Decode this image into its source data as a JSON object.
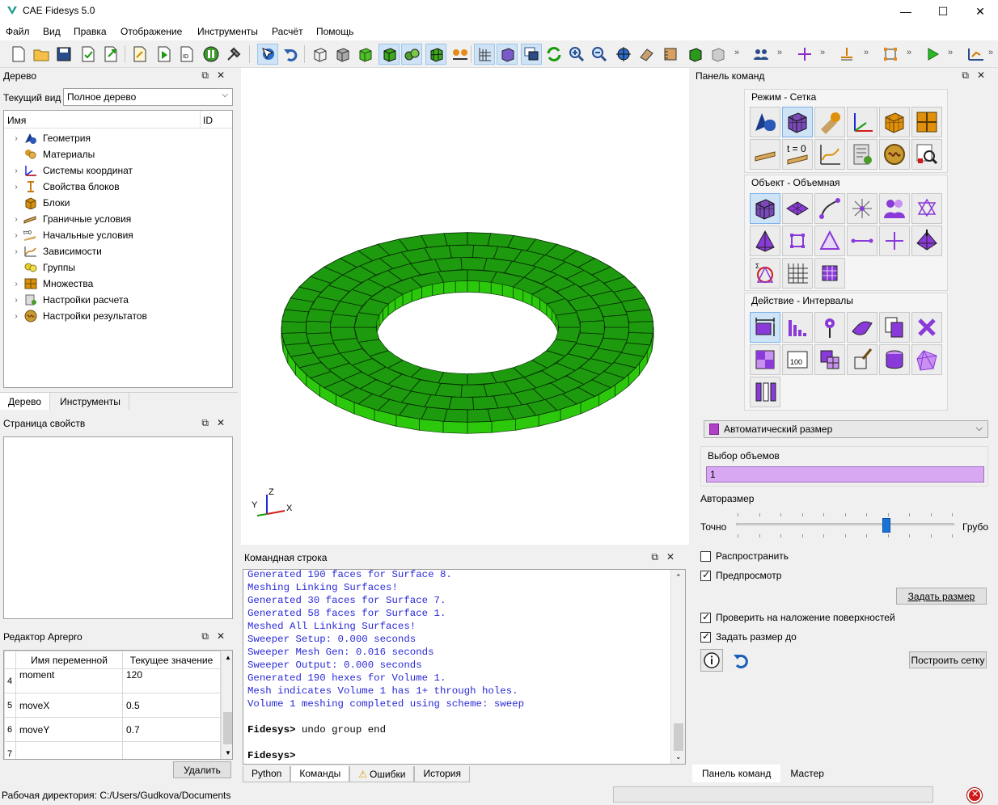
{
  "window": {
    "title": "CAE Fidesys 5.0",
    "minimize": "—",
    "maximize": "☐",
    "close": "✕"
  },
  "menu": [
    "Файл",
    "Вид",
    "Правка",
    "Отображение",
    "Инструменты",
    "Расчёт",
    "Помощь"
  ],
  "tree_panel": {
    "title": "Дерево",
    "view_label": "Текущий вид",
    "view_value": "Полное дерево",
    "col_name": "Имя",
    "col_id": "ID",
    "items": [
      {
        "label": "Геометрия",
        "expandable": true,
        "icon": "geometry-icon"
      },
      {
        "label": "Материалы",
        "expandable": false,
        "icon": "materials-icon"
      },
      {
        "label": "Системы координат",
        "expandable": true,
        "icon": "coordinate-systems-icon"
      },
      {
        "label": "Свойства блоков",
        "expandable": true,
        "icon": "block-properties-icon"
      },
      {
        "label": "Блоки",
        "expandable": false,
        "icon": "blocks-icon"
      },
      {
        "label": "Граничные условия",
        "expandable": true,
        "icon": "boundary-conditions-icon"
      },
      {
        "label": "Начальные условия",
        "expandable": true,
        "icon": "initial-conditions-icon"
      },
      {
        "label": "Зависимости",
        "expandable": true,
        "icon": "dependencies-icon"
      },
      {
        "label": "Группы",
        "expandable": false,
        "icon": "groups-icon"
      },
      {
        "label": "Множества",
        "expandable": true,
        "icon": "sets-icon"
      },
      {
        "label": "Настройки расчета",
        "expandable": true,
        "icon": "calc-settings-icon"
      },
      {
        "label": "Настройки результатов",
        "expandable": true,
        "icon": "results-settings-icon"
      }
    ],
    "tabs": [
      "Дерево",
      "Инструменты"
    ]
  },
  "property_panel": {
    "title": "Страница свойств"
  },
  "aprepro": {
    "title": "Редактор Aprepro",
    "col_name": "Имя переменной",
    "col_value": "Текущее значение",
    "rows": [
      {
        "n": "4",
        "name": "moment",
        "value": "120"
      },
      {
        "n": "5",
        "name": "moveX",
        "value": "0.5"
      },
      {
        "n": "6",
        "name": "moveY",
        "value": "0.7"
      },
      {
        "n": "7",
        "name": "",
        "value": ""
      }
    ],
    "delete_label": "Удалить"
  },
  "status_bar": {
    "workdir": "Рабочая директория: C:/Users/Gudkova/Documents"
  },
  "viewport": {
    "axis_x": "X",
    "axis_y": "Y",
    "axis_z": "Z",
    "mesh_color": "#1d9a0e"
  },
  "console": {
    "title": "Командная строка",
    "lines": [
      "Generated 190 faces for Surface 8.",
      "Meshing Linking Surfaces!",
      "Generated 30 faces for Surface 7.",
      "Generated 58 faces for Surface 1.",
      "Meshed All Linking Surfaces!",
      "Sweeper Setup: 0.000 seconds",
      "Sweeper Mesh Gen: 0.016 seconds",
      "Sweeper Output: 0.000 seconds",
      "Generated 190 hexes for Volume 1.",
      "Mesh indicates Volume 1 has 1+ through holes.",
      "Volume 1 meshing completed using scheme: sweep"
    ],
    "prompt1": "Fidesys>",
    "cmd1": " undo group end",
    "prompt2": "Fidesys>",
    "tabs": [
      "Python",
      "Команды",
      "Ошибки",
      "История"
    ]
  },
  "command_panel": {
    "title": "Панель команд",
    "group_mode": "Режим - Сетка",
    "group_object": "Объект - Объемная",
    "group_action": "Действие - Интервалы",
    "t0_label": "t = 0",
    "dropdown": "Автоматический размер",
    "volume_select_label": "Выбор объемов",
    "volume_select_value": "1",
    "autosize_label": "Авторазмер",
    "autosize_level": 0.7,
    "slider_left": "Точно",
    "slider_right": "Грубо",
    "propagate": "Распространить",
    "preview": "Предпросмотр",
    "set_size": "Задать размер",
    "check_overlap": "Проверить на наложение поверхностей",
    "set_size_to": "Задать размер до",
    "build_mesh": "Построить сетку",
    "tabs": [
      "Панель команд",
      "Мастер"
    ]
  }
}
